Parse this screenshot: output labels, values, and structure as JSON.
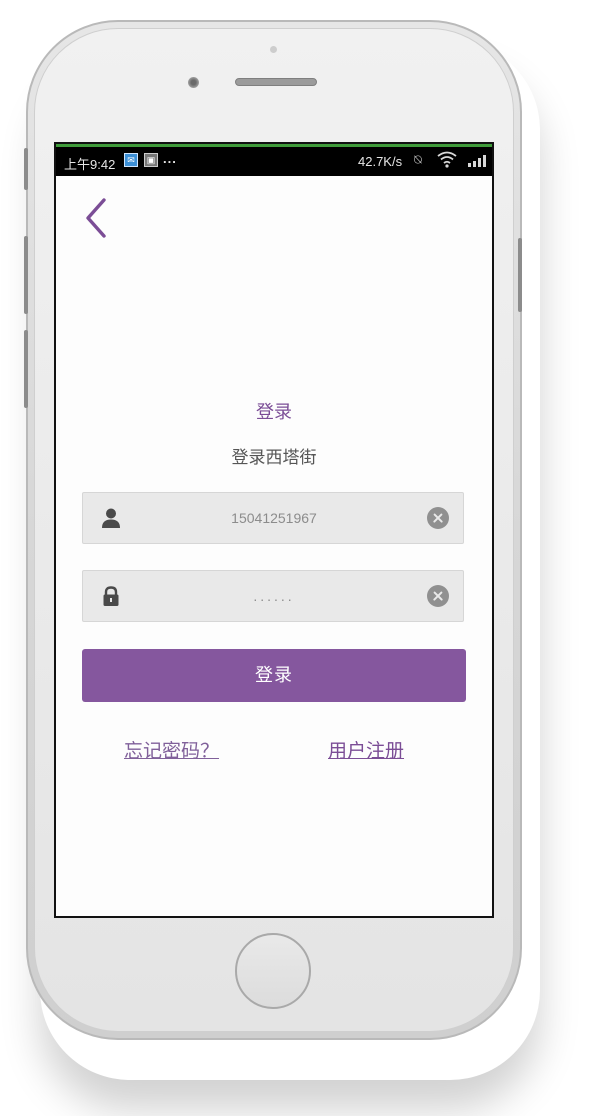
{
  "statusbar": {
    "time": "上午9:42",
    "more": "...",
    "net_speed": "42.7K/s"
  },
  "login": {
    "title": "登录",
    "subtitle": "登录西塔街",
    "phone_value": "15041251967",
    "password_value": "......",
    "submit_label": "登录",
    "forgot_label": "忘记密码？",
    "register_label": "用户注册"
  },
  "colors": {
    "accent": "#85579e",
    "text_purple": "#7b4d96",
    "field_bg": "#e9e9e9"
  },
  "icons": [
    "back-chevron-icon",
    "user-icon",
    "lock-icon",
    "clear-icon",
    "wifi-icon",
    "signal-icon",
    "mute-icon"
  ]
}
